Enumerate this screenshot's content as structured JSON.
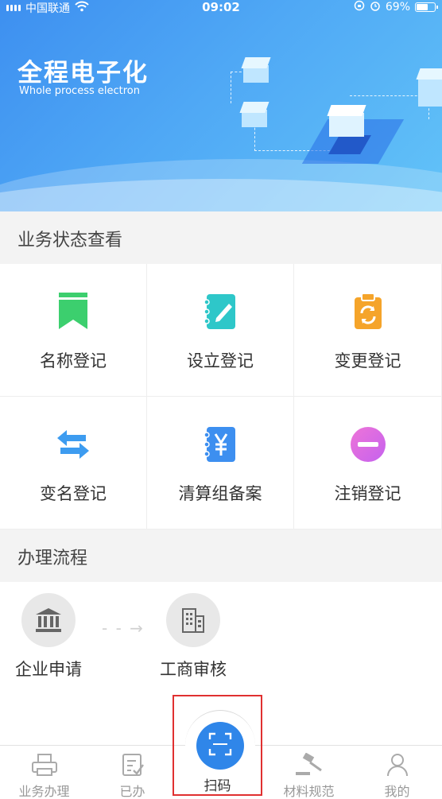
{
  "status_bar": {
    "carrier": "中国联通",
    "time": "09:02",
    "battery_percent": "69%",
    "battery_level": 0.69
  },
  "banner": {
    "title": "全程电子化",
    "subtitle": "Whole process electron"
  },
  "business_status": {
    "heading": "业务状态查看",
    "items": [
      {
        "label": "名称登记",
        "icon": "bookmark-icon",
        "color": "#3ccf6e"
      },
      {
        "label": "设立登记",
        "icon": "notebook-edit-icon",
        "color": "#2ec7c9"
      },
      {
        "label": "变更登记",
        "icon": "clipboard-refresh-icon",
        "color": "#f5a42a"
      },
      {
        "label": "变名登记",
        "icon": "swap-arrows-icon",
        "color": "#3d9cf0"
      },
      {
        "label": "清算组备案",
        "icon": "ledger-yen-icon",
        "color": "#3d8ff0"
      },
      {
        "label": "注销登记",
        "icon": "minus-circle-icon",
        "color": "#e36be0"
      }
    ]
  },
  "process": {
    "heading": "办理流程",
    "steps": [
      {
        "label": "企业申请",
        "icon": "bank-building-icon"
      },
      {
        "label": "工商审核",
        "icon": "office-building-icon"
      }
    ]
  },
  "tabbar": {
    "items": [
      {
        "label": "业务办理",
        "icon": "printer-icon"
      },
      {
        "label": "已办",
        "icon": "checklist-icon"
      },
      {
        "label": "扫码",
        "icon": "scan-icon"
      },
      {
        "label": "材料规范",
        "icon": "gavel-icon"
      },
      {
        "label": "我的",
        "icon": "user-icon"
      }
    ],
    "active_color": "#2f86e9"
  }
}
